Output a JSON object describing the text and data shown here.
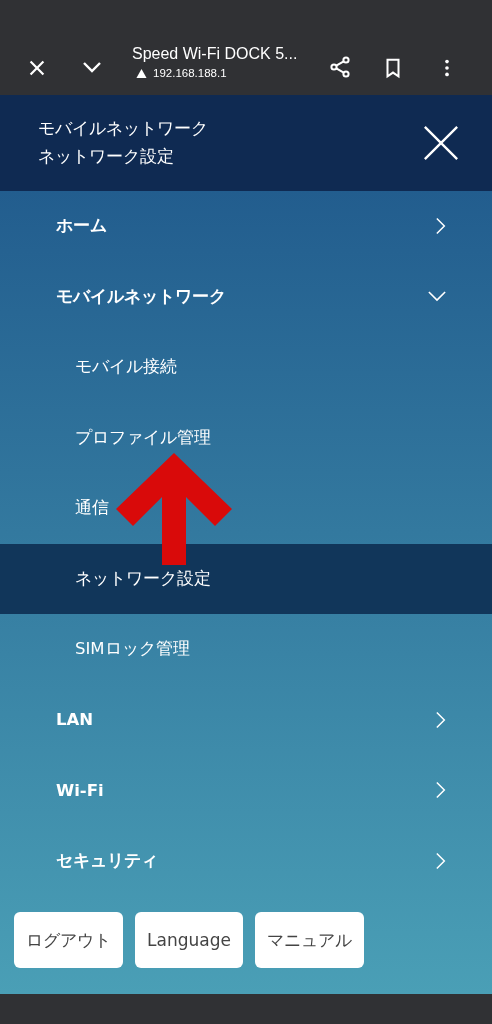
{
  "browser_bar": {
    "title": "Speed Wi-Fi DOCK 5...",
    "url": "192.168.188.1"
  },
  "header": {
    "lines": [
      "モバイルネットワーク",
      "ネットワーク設定"
    ]
  },
  "menu": [
    {
      "label": "ホーム",
      "expanded": false
    },
    {
      "label": "モバイルネットワーク",
      "expanded": true,
      "children": [
        {
          "label": "モバイル接続",
          "selected": false
        },
        {
          "label": "プロファイル管理",
          "selected": false
        },
        {
          "label": "通信",
          "selected": false
        },
        {
          "label": "ネットワーク設定",
          "selected": true
        },
        {
          "label": "SIMロック管理",
          "selected": false
        }
      ]
    },
    {
      "label": "LAN",
      "expanded": false
    },
    {
      "label": "Wi-Fi",
      "expanded": false
    },
    {
      "label": "セキュリティ",
      "expanded": false
    }
  ],
  "buttons": [
    "ログアウト",
    "Language",
    "マニュアル"
  ]
}
